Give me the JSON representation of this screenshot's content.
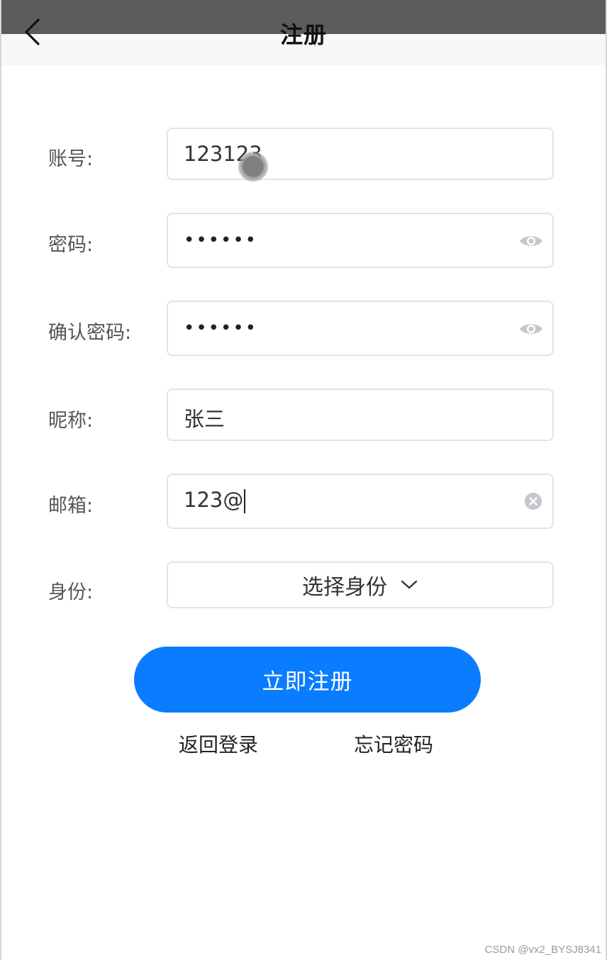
{
  "header": {
    "title": "注册",
    "back_icon": "chevron-left-icon"
  },
  "form": {
    "account": {
      "label": "账号:",
      "value": "123123"
    },
    "password": {
      "label": "密码:",
      "value": "••••••",
      "icon": "eye-icon"
    },
    "confirm_password": {
      "label": "确认密码:",
      "value": "••••••",
      "icon": "eye-icon"
    },
    "nickname": {
      "label": "昵称:",
      "value": "张三"
    },
    "email": {
      "label": "邮箱:",
      "value": "123@",
      "icon": "clear-icon"
    },
    "identity": {
      "label": "身份:",
      "value": "选择身份",
      "icon": "chevron-down-icon"
    }
  },
  "actions": {
    "submit_label": "立即注册",
    "back_to_login": "返回登录",
    "forgot_password": "忘记密码"
  },
  "watermark": "CSDN @vx2_BYSJ8341",
  "colors": {
    "primary": "#0a7cff",
    "status_bar": "#5c5c5c",
    "navbar": "#f7f7f7"
  }
}
